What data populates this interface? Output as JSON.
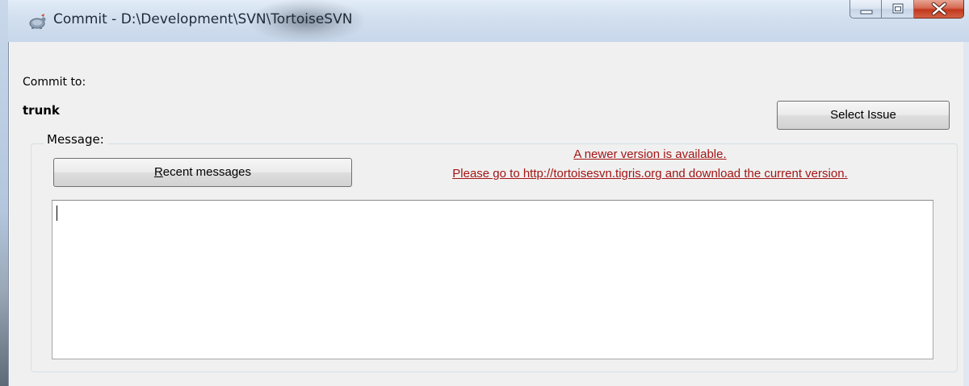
{
  "window": {
    "title": "Commit - D:\\Development\\SVN\\TortoiseSVN",
    "icon": "tortoisesvn-app-icon",
    "controls": {
      "minimize": "minimize-icon",
      "maximize": "maximize-icon",
      "close": "close-icon"
    }
  },
  "commit": {
    "label": "Commit to:",
    "target": "trunk",
    "select_issue_label": "Select Issue"
  },
  "message": {
    "group_label": "Message:",
    "recent_messages": {
      "mnemonic": "R",
      "rest": "ecent messages"
    },
    "update_notice": {
      "line1": "A newer version is available.",
      "line2": "Please go to http://tortoisesvn.tigris.org and download the current version."
    },
    "text_value": ""
  },
  "colors": {
    "notice_text": "#a31515",
    "close_button": "#c1371c",
    "dialog_background": "#f0f0f0"
  }
}
